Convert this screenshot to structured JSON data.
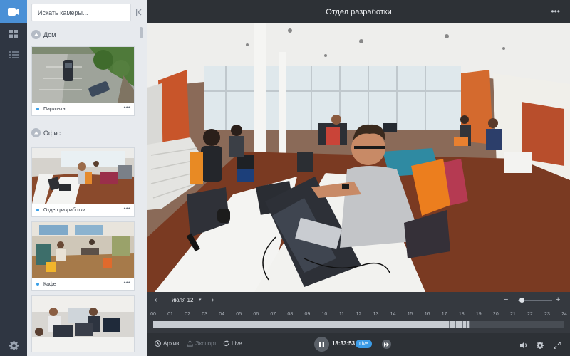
{
  "window": {
    "title": "Отдел разработки"
  },
  "rail": {
    "items": [
      {
        "icon": "video-camera-icon",
        "active": true
      },
      {
        "icon": "grid-icon",
        "active": false
      },
      {
        "icon": "list-icon",
        "active": false
      }
    ],
    "settings_icon": "gear-icon"
  },
  "sidebar": {
    "search_placeholder": "Искать камеры...",
    "groups": [
      {
        "label": "Дом",
        "cameras": [
          {
            "label": "Парковка"
          }
        ]
      },
      {
        "label": "Офис",
        "cameras": [
          {
            "label": "Отдел разработки"
          },
          {
            "label": "Кафе"
          },
          {
            "label": ""
          }
        ]
      }
    ]
  },
  "timeline": {
    "date": "июля 12",
    "hours": [
      "00",
      "01",
      "02",
      "03",
      "04",
      "05",
      "06",
      "07",
      "08",
      "09",
      "10",
      "11",
      "12",
      "13",
      "14",
      "15",
      "16",
      "17",
      "18",
      "19",
      "20",
      "21",
      "22",
      "23",
      "24"
    ],
    "zoom_level": 0.1,
    "recorded_until_hour": 18.5
  },
  "controls": {
    "archive_label": "Архив",
    "export_label": "Экспорт",
    "live_label": "Live",
    "current_time": "18:33:53",
    "live_badge": "Live"
  },
  "colors": {
    "accent": "#4a90d6",
    "live": "#3b9be6",
    "status_dot": "#3aa0e8"
  }
}
